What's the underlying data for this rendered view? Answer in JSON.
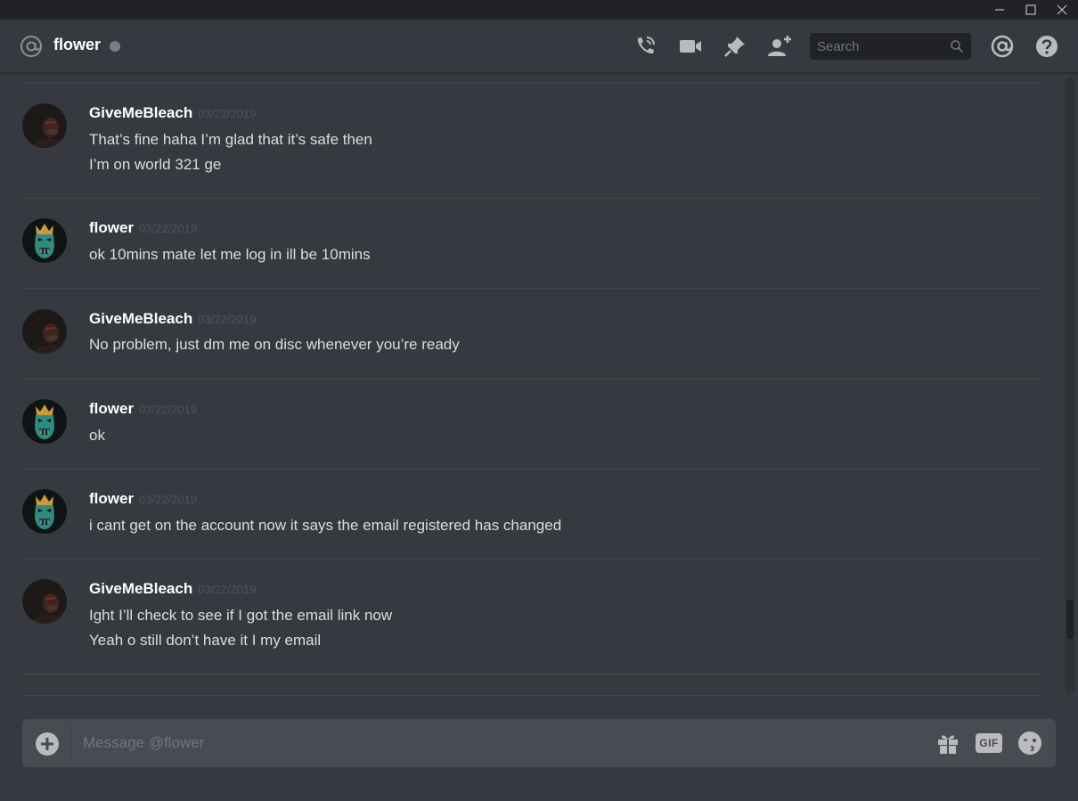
{
  "window": {
    "minimize_glyph": "—",
    "maximize_glyph": "☐",
    "close_glyph": "✕"
  },
  "header": {
    "channel_name": "flower",
    "status": "offline",
    "status_color": "#747f8d",
    "icons": [
      "at-icon",
      "call-icon",
      "video-icon",
      "pin-icon",
      "add-friend-icon",
      "mention-icon",
      "help-icon"
    ],
    "search_placeholder": "Search"
  },
  "messages": [
    {
      "author": "GiveMeBleach",
      "timestamp": "03/22/2019",
      "avatar": "photo-avatar",
      "lines": [
        "That’s fine haha I’m glad that it’s safe then",
        "I’m on world 321 ge"
      ]
    },
    {
      "author": "flower",
      "timestamp": "03/22/2019",
      "avatar": "mask-avatar",
      "lines": [
        "ok 10mins mate let me log in ill be 10mins"
      ]
    },
    {
      "author": "GiveMeBleach",
      "timestamp": "03/22/2019",
      "avatar": "photo-avatar",
      "lines": [
        "No problem, just dm me on disc whenever you’re ready"
      ]
    },
    {
      "author": "flower",
      "timestamp": "03/22/2019",
      "avatar": "mask-avatar",
      "lines": [
        "ok"
      ]
    },
    {
      "author": "flower",
      "timestamp": "03/22/2019",
      "avatar": "mask-avatar",
      "lines": [
        "i cant get on the account now it says the email registered has changed"
      ]
    },
    {
      "author": "GiveMeBleach",
      "timestamp": "03/22/2019",
      "avatar": "photo-avatar",
      "lines": [
        "Ight I’ll check to see if I got the email link now",
        "Yeah o still don’t have it I my email"
      ]
    }
  ],
  "composer": {
    "placeholder": "Message @flower",
    "gif_label": "GIF",
    "icons": [
      "plus-icon",
      "gift-icon",
      "gif-icon",
      "emoji-icon"
    ]
  },
  "colors": {
    "background": "#36393f",
    "titlebar": "#202225",
    "composer": "#484b51",
    "text": "#dcddde",
    "muted": "#72767d"
  }
}
